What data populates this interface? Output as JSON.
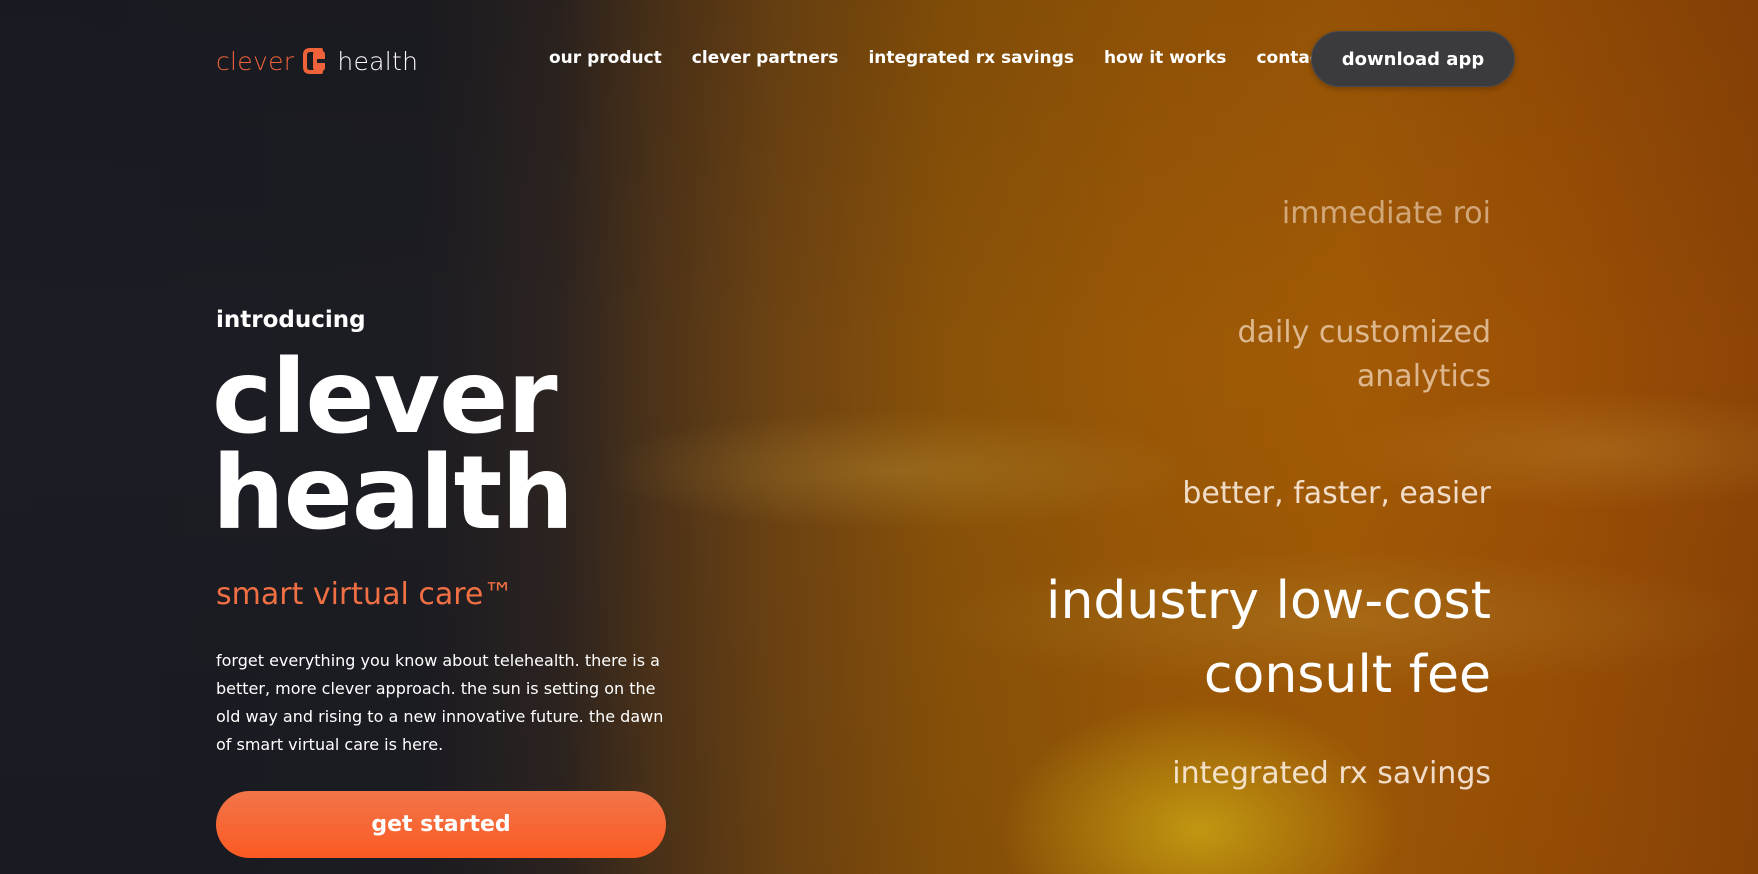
{
  "brand": {
    "name_left": "clever",
    "name_right": "health",
    "accent_color": "#f0623a"
  },
  "nav": {
    "items": [
      {
        "label": "our product"
      },
      {
        "label": "clever partners"
      },
      {
        "label": "integrated rx savings"
      },
      {
        "label": "how it works"
      },
      {
        "label": "contact us"
      }
    ],
    "download_label": "download app"
  },
  "hero": {
    "intro": "introducing",
    "title_line1": "clever",
    "title_line2": "health",
    "tagline": "smart virtual care™",
    "description": "forget everything you know about telehealth. there is a better, more clever approach. the sun is setting on the old way and rising to a new innovative future. the dawn of smart virtual care is here.",
    "cta_label": "get started",
    "cta_color": "#fb5a22"
  },
  "features": {
    "items": [
      {
        "line1": "immediate roi",
        "line2": ""
      },
      {
        "line1": "daily customized",
        "line2": "analytics"
      },
      {
        "line1": "better, faster, easier",
        "line2": ""
      },
      {
        "line1": "industry low-cost",
        "line2": "consult fee"
      },
      {
        "line1": "integrated rx savings",
        "line2": ""
      }
    ]
  }
}
